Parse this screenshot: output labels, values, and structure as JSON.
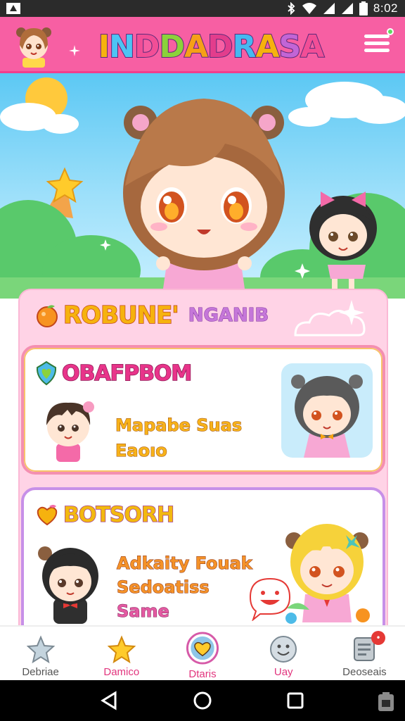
{
  "status_bar": {
    "time": "8:02",
    "icons": [
      "notification-icon",
      "bluetooth-icon",
      "wifi-icon",
      "signal-icon",
      "battery-icon"
    ]
  },
  "header": {
    "title": "INDDADRASA",
    "title_letter_colors": [
      "#f6b20e",
      "#4dc4f4",
      "#f24e96",
      "#8bd23a",
      "#f6a017",
      "#e33d8c",
      "#46b9f0",
      "#f6b20e",
      "#c265d6",
      "#f24e96"
    ],
    "avatar_icon": "girl-avatar",
    "menu_icon": "menu-icon"
  },
  "hero": {
    "character_icon": "anime-girl-character",
    "side_character_icon": "anime-girl-small-character"
  },
  "section": {
    "title": "ROBUNE'",
    "subtitle": "NGANIB",
    "icon": "orange-fruit-icon"
  },
  "cards": [
    {
      "title": "OBAFPBOM",
      "icon": "heart-shield-icon",
      "lines": [
        "Mapabe Suas",
        "Eaoıo"
      ]
    },
    {
      "title": "BOTSORH",
      "icon": "heart-icon",
      "lines": [
        "Adkaity Fouak",
        "Sedoatiss",
        "Same"
      ]
    }
  ],
  "bottom_nav": {
    "items": [
      {
        "label": "Debriae",
        "icon": "star-silver-icon",
        "active": false
      },
      {
        "label": "Damico",
        "icon": "star-gold-icon",
        "active": false
      },
      {
        "label": "Dtaris",
        "icon": "heart-circle-icon",
        "active": true
      },
      {
        "label": "Uay",
        "icon": "smiley-icon",
        "active": false
      },
      {
        "label": "Deoseais",
        "icon": "document-icon",
        "active": false,
        "badge": "•"
      }
    ]
  },
  "colors": {
    "header_bg": "#f75fa3",
    "panel_bg": "#ffd3e6",
    "active_nav": "#e2357e"
  }
}
